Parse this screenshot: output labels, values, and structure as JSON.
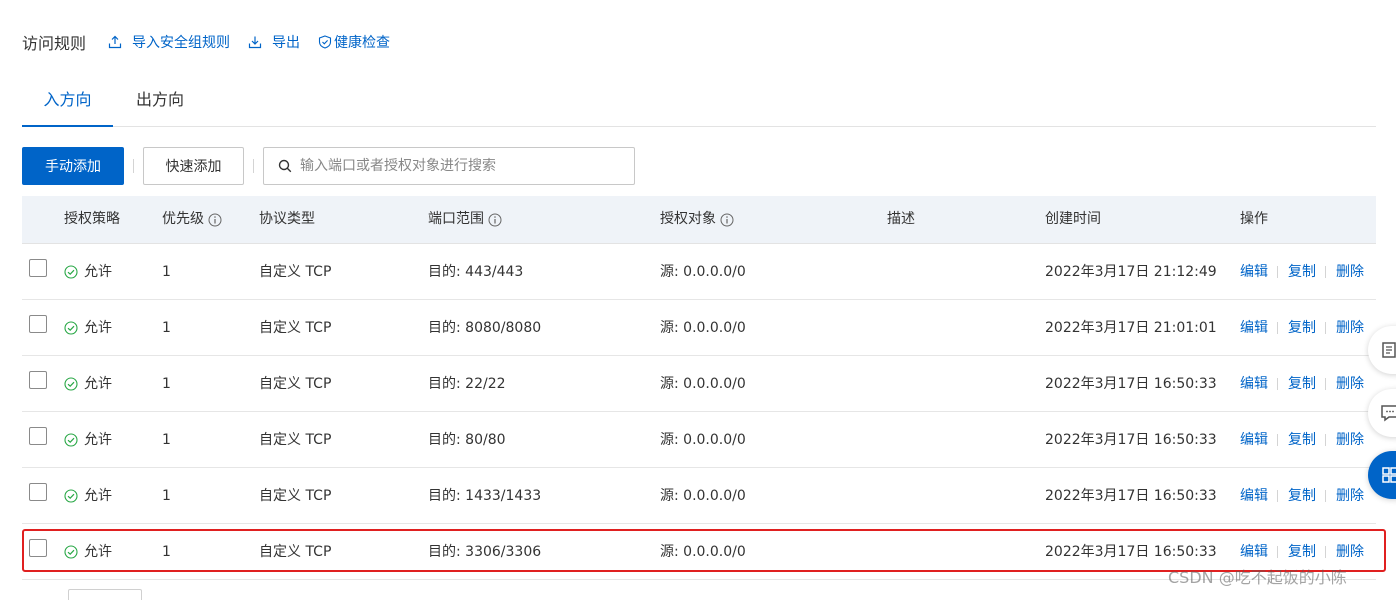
{
  "header": {
    "title": "访问规则",
    "import_label": "导入安全组规则",
    "export_label": "导出",
    "health_label": "健康检查"
  },
  "tabs": [
    {
      "label": "入方向",
      "active": true
    },
    {
      "label": "出方向",
      "active": false
    }
  ],
  "toolbar": {
    "manual_add_label": "手动添加",
    "quick_add_label": "快速添加",
    "search_placeholder": "输入端口或者授权对象进行搜索"
  },
  "table": {
    "columns": [
      "授权策略",
      "优先级",
      "协议类型",
      "端口范围",
      "授权对象",
      "描述",
      "创建时间",
      "操作"
    ],
    "rows": [
      {
        "policy": "允许",
        "priority": "1",
        "protocol": "自定义 TCP",
        "port": "目的: 443/443",
        "source": "源: 0.0.0.0/0",
        "description": "",
        "created": "2022年3月17日 21:12:49"
      },
      {
        "policy": "允许",
        "priority": "1",
        "protocol": "自定义 TCP",
        "port": "目的: 8080/8080",
        "source": "源: 0.0.0.0/0",
        "description": "",
        "created": "2022年3月17日 21:01:01"
      },
      {
        "policy": "允许",
        "priority": "1",
        "protocol": "自定义 TCP",
        "port": "目的: 22/22",
        "source": "源: 0.0.0.0/0",
        "description": "",
        "created": "2022年3月17日 16:50:33"
      },
      {
        "policy": "允许",
        "priority": "1",
        "protocol": "自定义 TCP",
        "port": "目的: 80/80",
        "source": "源: 0.0.0.0/0",
        "description": "",
        "created": "2022年3月17日 16:50:33"
      },
      {
        "policy": "允许",
        "priority": "1",
        "protocol": "自定义 TCP",
        "port": "目的: 1433/1433",
        "source": "源: 0.0.0.0/0",
        "description": "",
        "created": "2022年3月17日 16:50:33"
      },
      {
        "policy": "允许",
        "priority": "1",
        "protocol": "自定义 TCP",
        "port": "目的: 3306/3306",
        "source": "源: 0.0.0.0/0",
        "description": "",
        "created": "2022年3月17日 16:50:33"
      }
    ],
    "actions": {
      "edit": "编辑",
      "copy": "复制",
      "delete": "删除"
    }
  },
  "watermark": "CSDN @吃不起饭的小陈",
  "colors": {
    "accent": "#0064c8",
    "success": "#28a745",
    "highlight": "#e02020",
    "header_bg": "#eff3f8"
  }
}
